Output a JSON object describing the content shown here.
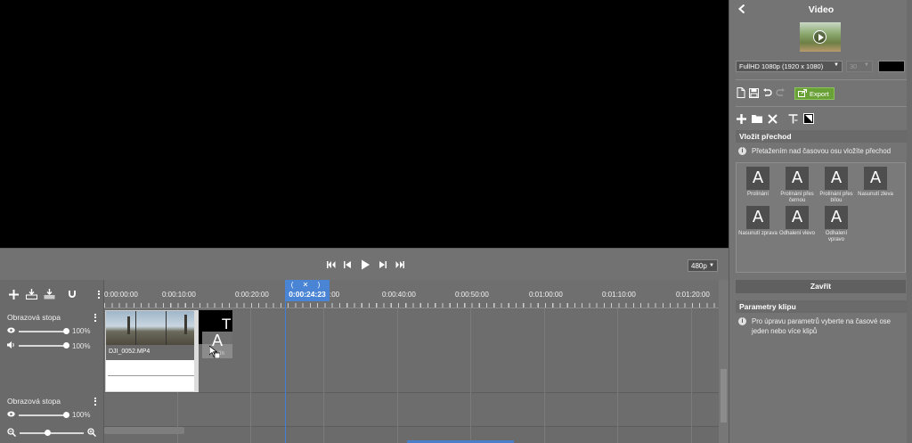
{
  "preview": {
    "resolution": "480p"
  },
  "timeline": {
    "playhead": "0:00:24:23",
    "playhead_symbols": "( ✕ )",
    "ruler": [
      "0:00:00:00",
      "0:00:10:00",
      "0:00:20:00",
      ":00",
      "0:00:40:00",
      "0:00:50:00",
      "0:01:00:00",
      "0:01:10:00",
      "0:01:20:00"
    ],
    "tracks": [
      {
        "name": "Obrazová stopa",
        "video_level": "100%",
        "audio_level": "100%"
      },
      {
        "name": "Obrazová stopa",
        "video_level": "100%"
      }
    ],
    "clip": {
      "filename": "DJI_0052.MP4"
    },
    "title_clip": {
      "letter": "T"
    },
    "drag_ghost": {
      "letter": "A",
      "caption": "Prolín"
    }
  },
  "panel": {
    "title": "Video",
    "resolution": "FullHD 1080p (1920 x 1080)",
    "fps": "30",
    "export_label": "Export",
    "insert_transition": {
      "header": "Vložit přechod",
      "hint": "Přetažením nad časovou osu vložíte přechod",
      "items": [
        {
          "letter": "A",
          "label": "Prolínání"
        },
        {
          "letter": "A",
          "label": "Prolínání přes černou"
        },
        {
          "letter": "A",
          "label": "Prolínání přes bílou"
        },
        {
          "letter": "A",
          "label": "Nasunutí zleva"
        },
        {
          "letter": "A",
          "label": "Nasunutí zprava"
        },
        {
          "letter": "A",
          "label": "Odhalení vlevo"
        },
        {
          "letter": "A",
          "label": "Odhalení vpravo"
        }
      ]
    },
    "close_label": "Zavřít",
    "clip_params": {
      "header": "Parametry klipu",
      "hint": "Pro úpravu parametrů vyberte na časové ose jeden nebo více klipů"
    }
  },
  "colors": {
    "accent": "#4a84d4",
    "export": "#6aa137"
  }
}
